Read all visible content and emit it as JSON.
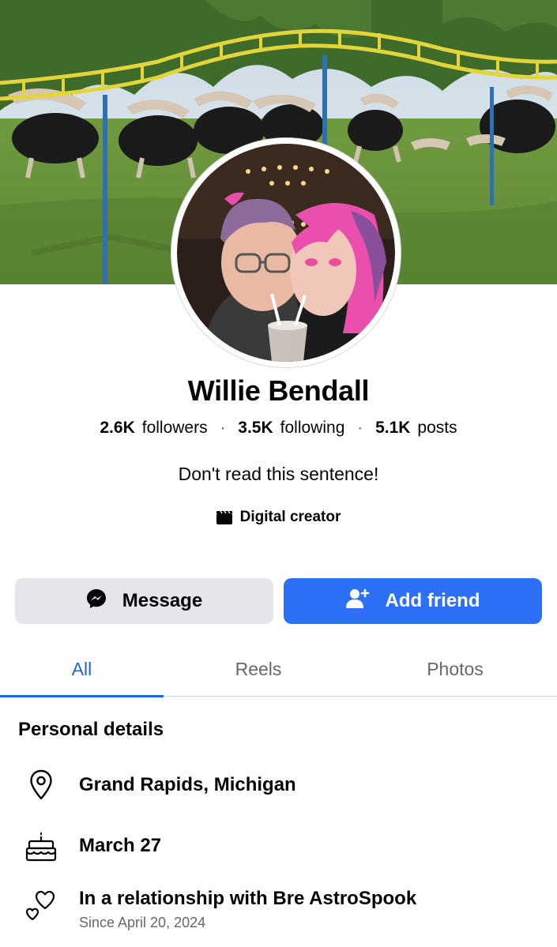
{
  "profile": {
    "name": "Willie Bendall",
    "bio": "Don't read this sentence!",
    "category": "Digital creator"
  },
  "stats": {
    "followers_count": "2.6K",
    "followers_label": "followers",
    "following_count": "3.5K",
    "following_label": "following",
    "posts_count": "5.1K",
    "posts_label": "posts",
    "separator": "·"
  },
  "actions": {
    "message_label": "Message",
    "add_friend_label": "Add friend"
  },
  "tabs": [
    {
      "label": "All",
      "active": true
    },
    {
      "label": "Reels",
      "active": false
    },
    {
      "label": "Photos",
      "active": false
    }
  ],
  "details": {
    "title": "Personal details",
    "location": "Grand Rapids, Michigan",
    "birthday": "March 27",
    "relationship": "In a relationship with Bre AstroSpook",
    "relationship_since": "Since April 20, 2024"
  },
  "colors": {
    "accent_blue": "#1f66d6",
    "button_blue": "#2d6ff5",
    "button_grey": "#e4e6eb",
    "secondary_text": "#65676b"
  },
  "icons": {
    "category": "clapperboard-icon",
    "message": "messenger-icon",
    "add_friend": "add-person-icon",
    "location": "map-pin-icon",
    "birthday": "birthday-cake-icon",
    "relationship": "hearts-icon"
  }
}
